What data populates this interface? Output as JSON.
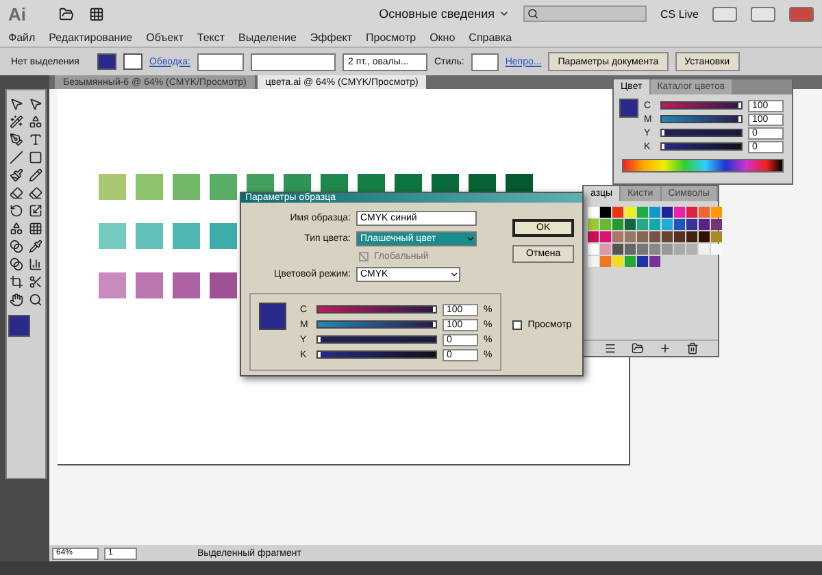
{
  "app_bar": {
    "logo": "Ai",
    "workspace": "Основные сведения",
    "cs_live": "CS Live"
  },
  "menu": [
    "Файл",
    "Редактирование",
    "Объект",
    "Текст",
    "Выделение",
    "Эффект",
    "Просмотр",
    "Окно",
    "Справка"
  ],
  "control_bar": {
    "selection": "Нет выделения",
    "stroke_label": "Обводка:",
    "brush": "2 пт., овалы...",
    "style_label": "Стиль:",
    "opacity_link": "Непро...",
    "buttons": [
      "Параметры документа",
      "Установки"
    ]
  },
  "doc_tabs": [
    {
      "label": "Безымянный-6 @ 64% (CMYK/Просмотр)",
      "selected": false
    },
    {
      "label": "цвета.ai @ 64% (CMYK/Просмотр)",
      "selected": true
    }
  ],
  "color_panel": {
    "tabs": [
      {
        "label": "Цвет",
        "selected": true
      },
      {
        "label": "Каталог цветов",
        "selected": false
      }
    ],
    "channels": [
      {
        "name": "C",
        "value": "100",
        "level": 1
      },
      {
        "name": "M",
        "value": "100",
        "level": 1
      },
      {
        "name": "Y",
        "value": "0",
        "level": 0
      },
      {
        "name": "K",
        "value": "0",
        "level": 0
      }
    ]
  },
  "swatches_panel": {
    "tabs": [
      {
        "label": "азцы",
        "selected": true
      },
      {
        "label": "Кисти",
        "selected": false
      },
      {
        "label": "Символы",
        "selected": false
      }
    ]
  },
  "dialog": {
    "title": "Параметры образца",
    "name_label": "Имя образца:",
    "name_value": "CMYK синий",
    "type_label": "Тип цвета:",
    "type_value": "Плашечный цвет",
    "global": {
      "label": "Глобальный",
      "checked": true,
      "disabled": true
    },
    "mode_label": "Цветовой режим:",
    "mode_value": "CMYK",
    "preview": {
      "label": "Просмотр",
      "checked": false
    },
    "channels": [
      {
        "name": "C",
        "value": "100",
        "unit": "%",
        "level": 1
      },
      {
        "name": "M",
        "value": "100",
        "unit": "%",
        "level": 1
      },
      {
        "name": "Y",
        "value": "0",
        "unit": "%",
        "level": 0
      },
      {
        "name": "K",
        "value": "0",
        "unit": "%",
        "level": 0
      }
    ],
    "buttons": [
      {
        "label": "OK",
        "focused": true
      },
      {
        "label": "Отмена",
        "focused": false
      }
    ]
  },
  "status_bar": {
    "zoom": "64%",
    "page": "1",
    "info": "Выделенный фрагмент"
  }
}
